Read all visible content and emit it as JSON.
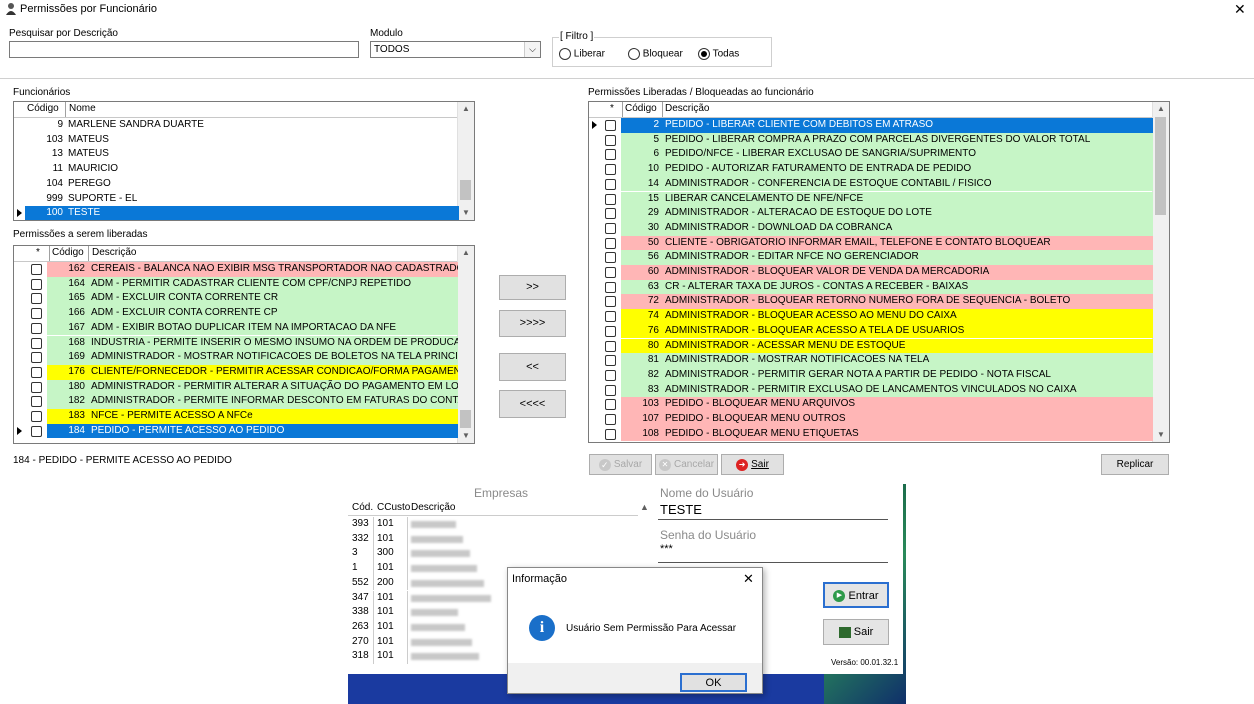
{
  "window": {
    "title": "Permissões por Funcionário",
    "close_label": "✕"
  },
  "search": {
    "label": "Pesquisar por Descrição",
    "value": ""
  },
  "modulo": {
    "label": "Modulo",
    "selected": "TODOS"
  },
  "filtro": {
    "legend": "[ Filtro ]",
    "options": [
      "Liberar",
      "Bloquear",
      "Todas"
    ],
    "selected": "Todas"
  },
  "funcionarios": {
    "label": "Funcionários",
    "headers": [
      "Código",
      "Nome"
    ],
    "rows": [
      {
        "code": "9",
        "name": "MARLENE SANDRA DUARTE"
      },
      {
        "code": "103",
        "name": "MATEUS"
      },
      {
        "code": "13",
        "name": "MATEUS"
      },
      {
        "code": "11",
        "name": "MAURICIO"
      },
      {
        "code": "104",
        "name": "PEREGO"
      },
      {
        "code": "999",
        "name": "SUPORTE - EL"
      },
      {
        "code": "100",
        "name": "TESTE",
        "selected": true
      }
    ]
  },
  "permissoes_liberar": {
    "label": "Permissões a serem liberadas",
    "headers": [
      "*",
      "Código",
      "Descrição"
    ],
    "rows": [
      {
        "code": "162",
        "desc": "CEREAIS - BALANCA NAO EXIBIR MSG TRANSPORTADOR NAO CADASTRADO",
        "color": "#ffb6b6"
      },
      {
        "code": "164",
        "desc": "ADM - PERMITIR CADASTRAR CLIENTE COM CPF/CNPJ REPETIDO",
        "color": "#c6f5c6"
      },
      {
        "code": "165",
        "desc": "ADM - EXCLUIR CONTA CORRENTE CR",
        "color": "#c6f5c6"
      },
      {
        "code": "166",
        "desc": "ADM - EXCLUIR CONTA CORRENTE CP",
        "color": "#c6f5c6"
      },
      {
        "code": "167",
        "desc": "ADM - EXIBIR BOTAO DUPLICAR ITEM NA IMPORTACAO DA NFE",
        "color": "#c6f5c6"
      },
      {
        "code": "168",
        "desc": "INDUSTRIA - PERMITE INSERIR O MESMO INSUMO NA ORDEM DE PRODUCAO",
        "color": "#c6f5c6"
      },
      {
        "code": "169",
        "desc": "ADMINISTRADOR - MOSTRAR NOTIFICACOES DE BOLETOS NA TELA PRINCIPAL",
        "color": "#c6f5c6"
      },
      {
        "code": "176",
        "desc": "CLIENTE/FORNECEDOR - PERMITIR ACESSAR CONDICAO/FORMA PAGAMENTO",
        "color": "#ffff00"
      },
      {
        "code": "180",
        "desc": "ADMINISTRADOR - PERMITIR ALTERAR A SITUAÇÃO DO PAGAMENTO EM LOTE",
        "color": "#c6f5c6"
      },
      {
        "code": "182",
        "desc": "ADMINISTRADOR - PERMITE INFORMAR DESCONTO EM FATURAS DO CONTAS",
        "color": "#c6f5c6"
      },
      {
        "code": "183",
        "desc": "NFCE - PERMITE ACESSO A NFCe",
        "color": "#ffff00"
      },
      {
        "code": "184",
        "desc": "PEDIDO - PERMITE ACESSO AO PEDIDO",
        "color": "#0a78d7",
        "selected": true
      }
    ]
  },
  "permissoes_func": {
    "label": "Permissões Liberadas / Bloqueadas ao funcionário",
    "headers": [
      "*",
      "Código",
      "Descrição"
    ],
    "rows": [
      {
        "code": "2",
        "desc": "PEDIDO - LIBERAR CLIENTE COM DEBITOS EM ATRASO",
        "color": "#0a78d7",
        "selected": true
      },
      {
        "code": "5",
        "desc": "PEDIDO - LIBERAR COMPRA A PRAZO COM PARCELAS DIVERGENTES DO VALOR TOTAL",
        "color": "#c6f5c6"
      },
      {
        "code": "6",
        "desc": "PEDIDO/NFCE - LIBERAR EXCLUSAO DE SANGRIA/SUPRIMENTO",
        "color": "#c6f5c6"
      },
      {
        "code": "10",
        "desc": "PEDIDO - AUTORIZAR FATURAMENTO DE ENTRADA DE PEDIDO",
        "color": "#c6f5c6"
      },
      {
        "code": "14",
        "desc": "ADMINISTRADOR - CONFERENCIA DE ESTOQUE CONTABIL / FISICO",
        "color": "#c6f5c6"
      },
      {
        "code": "15",
        "desc": "LIBERAR CANCELAMENTO DE NFE/NFCE",
        "color": "#c6f5c6"
      },
      {
        "code": "29",
        "desc": "ADMINISTRADOR - ALTERACAO DE ESTOQUE DO LOTE",
        "color": "#c6f5c6"
      },
      {
        "code": "30",
        "desc": "ADMINISTRADOR - DOWNLOAD DA COBRANCA",
        "color": "#c6f5c6"
      },
      {
        "code": "50",
        "desc": "CLIENTE - OBRIGATORIO INFORMAR EMAIL, TELEFONE E CONTATO BLOQUEAR",
        "color": "#ffb6b6"
      },
      {
        "code": "56",
        "desc": "ADMINISTRADOR - EDITAR NFCE NO GERENCIADOR",
        "color": "#c6f5c6"
      },
      {
        "code": "60",
        "desc": "ADMINISTRADOR - BLOQUEAR VALOR DE VENDA DA MERCADORIA",
        "color": "#ffb6b6"
      },
      {
        "code": "63",
        "desc": "CR - ALTERAR TAXA DE JUROS - CONTAS A RECEBER - BAIXAS",
        "color": "#c6f5c6"
      },
      {
        "code": "72",
        "desc": "ADMINISTRADOR - BLOQUEAR RETORNO NUMERO FORA DE SEQUENCIA - BOLETO",
        "color": "#ffb6b6"
      },
      {
        "code": "74",
        "desc": "ADMINISTRADOR - BLOQUEAR ACESSO AO MENU DO CAIXA",
        "color": "#ffff00"
      },
      {
        "code": "76",
        "desc": "ADMINISTRADOR - BLOQUEAR ACESSO A TELA DE USUARIOS",
        "color": "#ffff00"
      },
      {
        "code": "80",
        "desc": "ADMINISTRADOR - ACESSAR MENU DE ESTOQUE",
        "color": "#ffff00"
      },
      {
        "code": "81",
        "desc": "ADMINISTRADOR - MOSTRAR NOTIFICACOES NA TELA",
        "color": "#c6f5c6"
      },
      {
        "code": "82",
        "desc": "ADMINISTRADOR - PERMITIR GERAR NOTA A PARTIR DE PEDIDO - NOTA FISCAL",
        "color": "#c6f5c6"
      },
      {
        "code": "83",
        "desc": "ADMINISTRADOR - PERMITIR EXCLUSAO DE LANCAMENTOS VINCULADOS NO CAIXA",
        "color": "#c6f5c6"
      },
      {
        "code": "103",
        "desc": "PEDIDO - BLOQUEAR MENU ARQUIVOS",
        "color": "#ffb6b6"
      },
      {
        "code": "107",
        "desc": "PEDIDO - BLOQUEAR MENU OUTROS",
        "color": "#ffb6b6"
      },
      {
        "code": "108",
        "desc": "PEDIDO - BLOQUEAR MENU ETIQUETAS",
        "color": "#ffb6b6"
      }
    ]
  },
  "transfer_buttons": [
    ">>",
    ">>>>",
    "<<",
    "<<<<"
  ],
  "actions": {
    "salvar": "Salvar",
    "cancelar": "Cancelar",
    "sair": "Sair",
    "replicar": "Replicar"
  },
  "status_text": "184 - PEDIDO - PERMITE ACESSO AO PEDIDO",
  "login": {
    "empresas_title": "Empresas",
    "headers": [
      "Cód.",
      "CCusto",
      "Descrição"
    ],
    "rows": [
      {
        "cod": "393",
        "cc": "101"
      },
      {
        "cod": "332",
        "cc": "101"
      },
      {
        "cod": "3",
        "cc": "300"
      },
      {
        "cod": "1",
        "cc": "101"
      },
      {
        "cod": "552",
        "cc": "200"
      },
      {
        "cod": "347",
        "cc": "101"
      },
      {
        "cod": "338",
        "cc": "101"
      },
      {
        "cod": "263",
        "cc": "101"
      },
      {
        "cod": "270",
        "cc": "101"
      },
      {
        "cod": "318",
        "cc": "101"
      }
    ],
    "user_label": "Nome do Usuário",
    "user_value": "TESTE",
    "pass_label": "Senha do Usuário",
    "pass_value": "***",
    "entrar": "Entrar",
    "sair": "Sair",
    "versao": "Versão: 00.01.32.1"
  },
  "dialog": {
    "title": "Informação",
    "message": "Usuário Sem Permissão Para Acessar",
    "ok": "OK",
    "close": "✕"
  },
  "colors": {
    "selected": "#0a78d7",
    "green": "#c6f5c6",
    "red": "#ffb6b6",
    "yellow": "#ffff00"
  }
}
